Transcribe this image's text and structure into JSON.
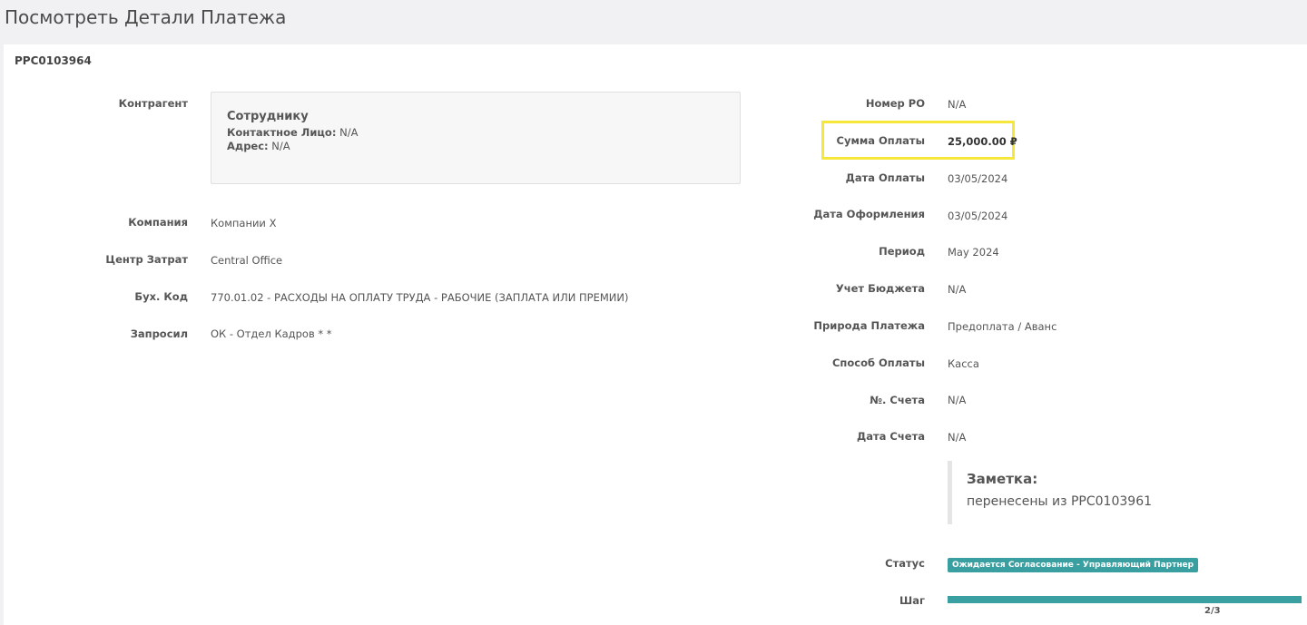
{
  "page": {
    "title": "Посмотреть Детали Платежа",
    "reference": "PPC0103964"
  },
  "left": {
    "vendor_label": "Контрагент",
    "vendor": {
      "name": "Сотруднику",
      "contact_label": "Контактное Лицо:",
      "contact_value": "N/A",
      "address_label": "Адрес:",
      "address_value": "N/A"
    },
    "company_label": "Компания",
    "company_value": "Компании X",
    "cost_center_label": "Центр Затрат",
    "cost_center_value": "Central Office",
    "account_code_label": "Бух. Код",
    "account_code_value": "770.01.02 - РАСХОДЫ НА ОПЛАТУ ТРУДА - РАБОЧИЕ (ЗАПЛАТА ИЛИ ПРЕМИИ)",
    "requested_by_label": "Запросил",
    "requested_by_value": "ОК - Отдел Кадров * *"
  },
  "right": {
    "po_label": "Номер PO",
    "po_value": "N/A",
    "amount_label": "Сумма Оплаты",
    "amount_value": "25,000.00 ₽",
    "payment_date_label": "Дата Оплаты",
    "payment_date_value": "03/05/2024",
    "issue_date_label": "Дата Оформления",
    "issue_date_value": "03/05/2024",
    "period_label": "Период",
    "period_value": "May 2024",
    "budget_label": "Учет Бюджета",
    "budget_value": "N/A",
    "nature_label": "Природа Платежа",
    "nature_value": "Предоплата / Аванс",
    "method_label": "Способ Оплаты",
    "method_value": "Касса",
    "invoice_no_label": "№. Счета",
    "invoice_no_value": "N/A",
    "invoice_date_label": "Дата Счета",
    "invoice_date_value": "N/A",
    "note_title": "Заметка:",
    "note_text": "перенесены из PPC0103961",
    "status_label": "Статус",
    "status_value": "Ожидается Согласование - Управляющий Партнер",
    "step_label": "Шаг",
    "step_value": "2/3",
    "step_progress_fraction": 1.0
  },
  "colors": {
    "accent": "#3a9fa0",
    "highlight": "#f5e83a"
  }
}
